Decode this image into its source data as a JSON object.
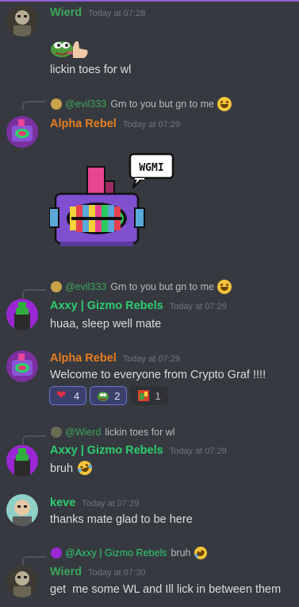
{
  "messages": [
    {
      "author": "Wierd",
      "author_color": "#3ba55c",
      "timestamp": "Today at 07:28",
      "sticker": "pepe-licking-toes-emoji",
      "text": "lickin toes for wl"
    },
    {
      "reply": {
        "author": "@evil333",
        "text": "Gm to you but gn to me",
        "emoji": "grinning-face-icon"
      },
      "author": "Alpha Rebel",
      "author_color": "#e67e22",
      "timestamp": "Today at 07:29",
      "sticker": "gizmo-robot-wgmi-sticker",
      "sticker_text": "WGMI"
    },
    {
      "reply": {
        "author": "@evil333",
        "text": "Gm to you but gn to me",
        "emoji": "grinning-face-icon"
      },
      "author": "Axxy | Gizmo Rebels",
      "author_color": "#2ecc71",
      "timestamp": "Today at 07:29",
      "text": "huaa, sleep well mate"
    },
    {
      "author": "Alpha Rebel",
      "author_color": "#e67e22",
      "timestamp": "Today at 07:29",
      "text": "Welcome to everyone from Crypto Graf !!!!",
      "reactions": [
        {
          "icon": "red-heart-icon",
          "count": "4",
          "active": true
        },
        {
          "icon": "pepe-emoji-icon",
          "count": "2",
          "active": true
        },
        {
          "icon": "custom-emoji-icon",
          "count": "1",
          "active": false
        }
      ]
    },
    {
      "reply": {
        "author": "@Wierd",
        "text": "lickin toes for wl"
      },
      "author": "Axxy | Gizmo Rebels",
      "author_color": "#2ecc71",
      "timestamp": "Today at 07:29",
      "text": "bruh",
      "text_emoji": "rolling-on-floor-laughing-icon"
    },
    {
      "author": "keve",
      "author_color": "#2ecc71",
      "timestamp": "Today at 07:29",
      "text": "thanks mate glad to be here"
    },
    {
      "reply": {
        "author": "@Axxy | Gizmo Rebels",
        "text": "bruh",
        "emoji": "rolling-on-floor-laughing-icon"
      },
      "author": "Wierd",
      "author_color": "#3ba55c",
      "timestamp": "Today at 07:30",
      "text": "get  me some WL and Ill lick in between them"
    }
  ],
  "colors": {
    "background": "#36393f",
    "text": "#dcddde",
    "muted": "#72767d",
    "reaction_bg": "#2f3136",
    "reaction_active_border": "#6e72d8"
  }
}
